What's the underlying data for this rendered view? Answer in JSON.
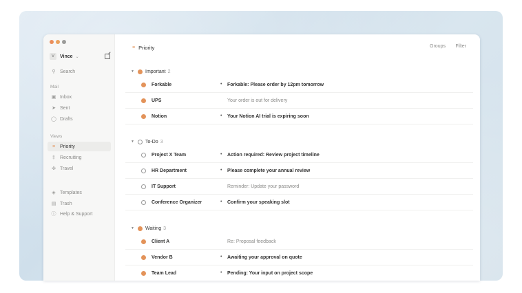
{
  "sidebar": {
    "traffic_colors": [
      "#ea8e5b",
      "#eba25e",
      "#9b9b99"
    ],
    "account": {
      "avatar": "V",
      "name": "Vince"
    },
    "search_label": "Search",
    "mail_section": "Mail",
    "mail_items": [
      {
        "label": "Inbox",
        "icon": "inbox-icon"
      },
      {
        "label": "Sent",
        "icon": "send-icon"
      },
      {
        "label": "Drafts",
        "icon": "draft-icon"
      }
    ],
    "views_section": "Views",
    "view_items": [
      {
        "label": "Priority",
        "icon": "priority-icon",
        "active": true
      },
      {
        "label": "Recruiting",
        "icon": "recruiting-icon"
      },
      {
        "label": "Travel",
        "icon": "plane-icon"
      }
    ],
    "bottom_items": [
      {
        "label": "Templates",
        "icon": "templates-icon"
      },
      {
        "label": "Trash",
        "icon": "trash-icon"
      },
      {
        "label": "Help & Support",
        "icon": "help-icon"
      }
    ]
  },
  "header": {
    "title": "Priority",
    "groups_label": "Groups",
    "filter_label": "Filter"
  },
  "groups": [
    {
      "label": "Important",
      "count": "2",
      "dot": "filled",
      "rows": [
        {
          "sender": "Forkable",
          "subject": "Forkable: Please order by 12pm tomorrow",
          "unread": true
        },
        {
          "sender": "UPS",
          "subject": "Your order is out for delivery",
          "unread": false
        },
        {
          "sender": "Notion",
          "subject": "Your Notion AI trial is expiring soon",
          "unread": true
        }
      ]
    },
    {
      "label": "To-Do",
      "count": "3",
      "dot": "hollow",
      "rows": [
        {
          "sender": "Project X Team",
          "subject": "Action required: Review project timeline",
          "unread": true
        },
        {
          "sender": "HR Department",
          "subject": "Please complete your annual review",
          "unread": true
        },
        {
          "sender": "IT Support",
          "subject": "Reminder: Update your password",
          "unread": false
        },
        {
          "sender": "Conference Organizer",
          "subject": "Confirm your speaking slot",
          "unread": true
        }
      ]
    },
    {
      "label": "Waiting",
      "count": "3",
      "dot": "filled",
      "rows": [
        {
          "sender": "Client A",
          "subject": "Re: Proposal feedback",
          "unread": false
        },
        {
          "sender": "Vendor B",
          "subject": "Awaiting your approval on quote",
          "unread": true
        },
        {
          "sender": "Team Lead",
          "subject": "Pending: Your input on project scope",
          "unread": true
        }
      ]
    }
  ],
  "colors": {
    "accent": "#e3935a"
  }
}
